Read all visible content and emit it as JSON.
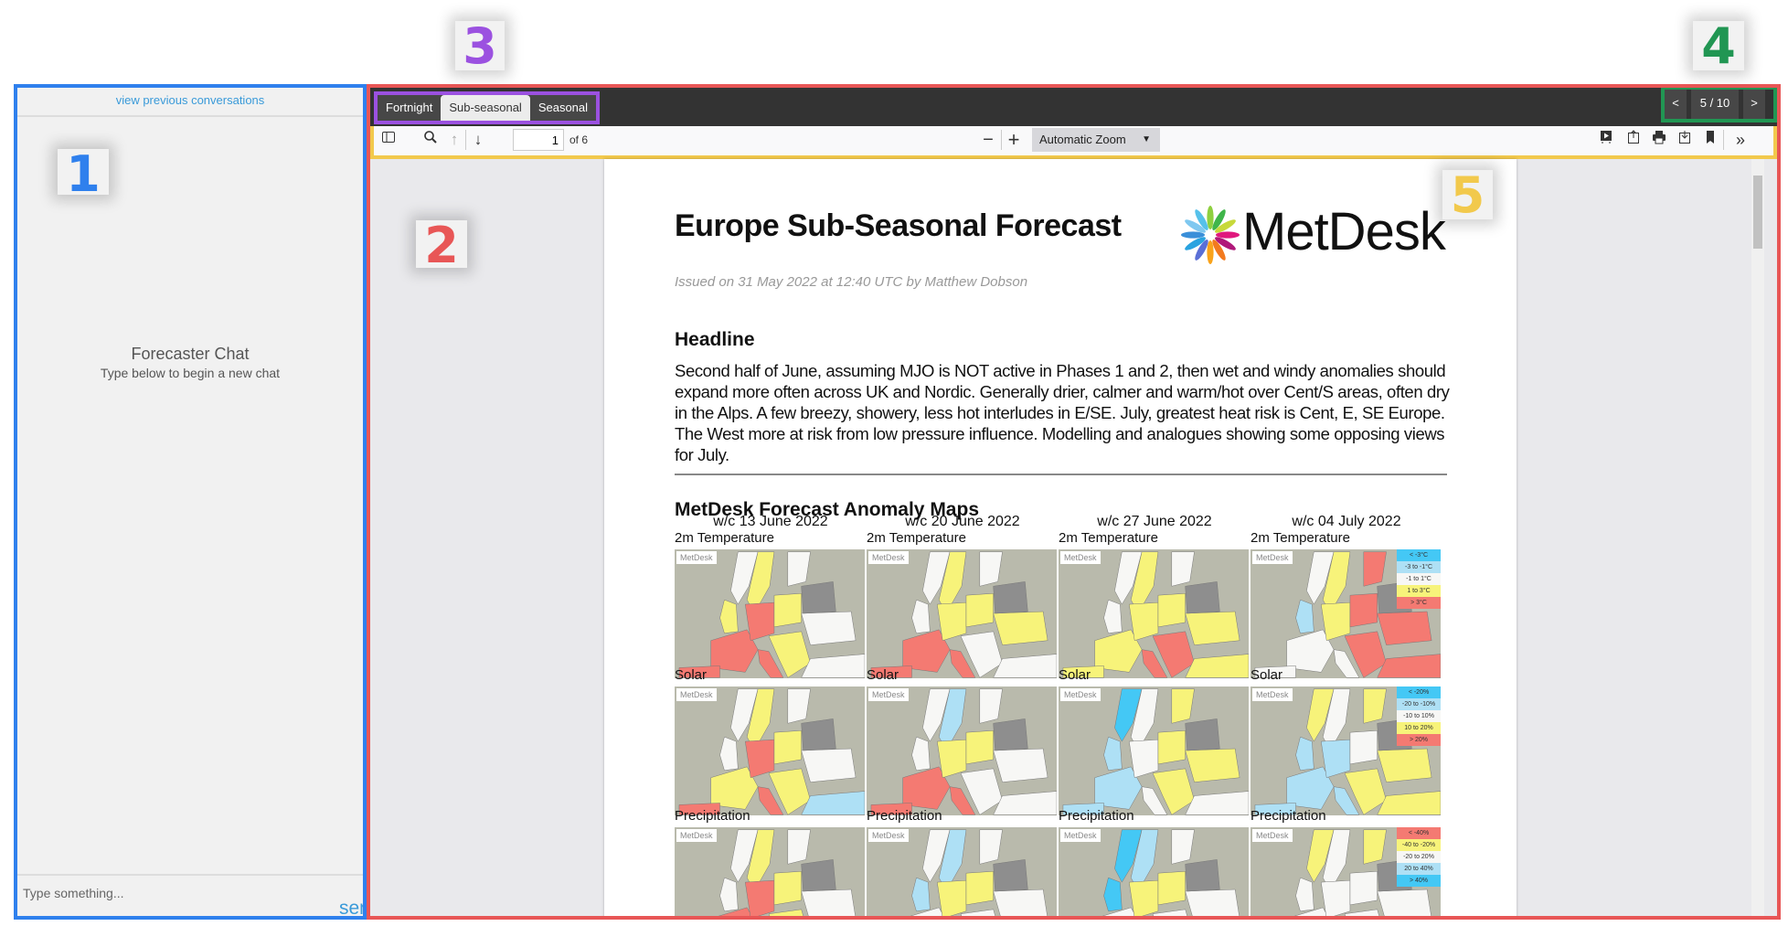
{
  "annotations": [
    {
      "label": "1",
      "color": "#2f80ed"
    },
    {
      "label": "2",
      "color": "#e85656"
    },
    {
      "label": "3",
      "color": "#9b51e0"
    },
    {
      "label": "4",
      "color": "#219653"
    },
    {
      "label": "5",
      "color": "#f2c94c"
    }
  ],
  "chat": {
    "previous_link": "view previous conversations",
    "title": "Forecaster Chat",
    "subtitle": "Type below to begin a new chat",
    "input_placeholder": "Type something...",
    "send_label": "send"
  },
  "tabs": [
    {
      "label": "Fortnight"
    },
    {
      "label": "Sub-seasonal",
      "active": true
    },
    {
      "label": "Seasonal"
    }
  ],
  "nav": {
    "prev": "<",
    "counter": "5 / 10",
    "next": ">"
  },
  "toolbar": {
    "page_value": "1",
    "page_total": "of 6",
    "zoom": "Automatic Zoom",
    "icons": [
      "sidebar-toggle-icon",
      "search-icon",
      "arrow-up-icon",
      "arrow-down-icon",
      "minus-icon",
      "plus-icon",
      "presentation-icon",
      "open-file-icon",
      "print-icon",
      "download-icon",
      "bookmark-icon",
      "more-tools-icon"
    ]
  },
  "document": {
    "title": "Europe Sub-Seasonal Forecast",
    "logo_text": "MetDesk",
    "issued": "Issued on 31 May 2022 at 12:40 UTC by Matthew Dobson",
    "headline_heading": "Headline",
    "headline_text": "Second half of June, assuming MJO is NOT active in Phases 1 and 2, then wet and windy anomalies should expand more often across UK and Nordic. Generally drier, calmer and warm/hot over Cent/S areas, often dry in the Alps. A few breezy, showery, less hot interludes in E/SE. July, greatest heat risk is Cent, E, SE Europe. The West more at risk from low pressure influence. Modelling and analogues showing some opposing views for July.",
    "maps_heading": "MetDesk Forecast Anomaly Maps",
    "weeks": [
      "w/c 13 June 2022",
      "w/c 20 June 2022",
      "w/c 27 June 2022",
      "w/c 04 July 2022"
    ],
    "map_watermark": "MetDesk",
    "colors": {
      "r": "#f47a72",
      "y": "#f7f37a",
      "w": "#f7f7f5",
      "l": "#aee0f5",
      "b": "#44c8f5",
      "sea": "#b9baac",
      "land": "#8e8e8e"
    },
    "rows": [
      {
        "label": "2m Temperature",
        "legend": [
          [
            "< -3°C",
            "b"
          ],
          [
            "-3 to -1°C",
            "l"
          ],
          [
            "-1 to 1°C",
            "w"
          ],
          [
            "1 to 3°C",
            "y"
          ],
          [
            "> 3°C",
            "r"
          ]
        ],
        "maps": [
          "wywyrrrryywwg",
          "wywwrrryywywg",
          "wywwyyryyryyg",
          "wyrlwwwyrrrrg"
        ]
      },
      {
        "label": "Solar",
        "legend": [
          [
            "< -20%",
            "b"
          ],
          [
            "-20 to -10%",
            "l"
          ],
          [
            "-10 to 10%",
            "w"
          ],
          [
            "10 to 20%",
            "y"
          ],
          [
            "> 20%",
            "r"
          ]
        ],
        "maps": [
          "wywwyrrryywlg",
          "wlwwrrryywwwg",
          "bwylllwwyyywg",
          "ywylllllwyyyg"
        ]
      },
      {
        "label": "Precipitation",
        "legend": [
          [
            "< -40%",
            "r"
          ],
          [
            "-40 to -20%",
            "y"
          ],
          [
            "-20 to 20%",
            "w"
          ],
          [
            "20 to 40%",
            "l"
          ],
          [
            "> 40%",
            "b"
          ]
        ],
        "maps": [
          "wywwrrrryywwg",
          "wlwlwwwyywwwg",
          "blwbwwwyywwwg",
          "ywywwwwwwwwwg"
        ]
      }
    ]
  }
}
